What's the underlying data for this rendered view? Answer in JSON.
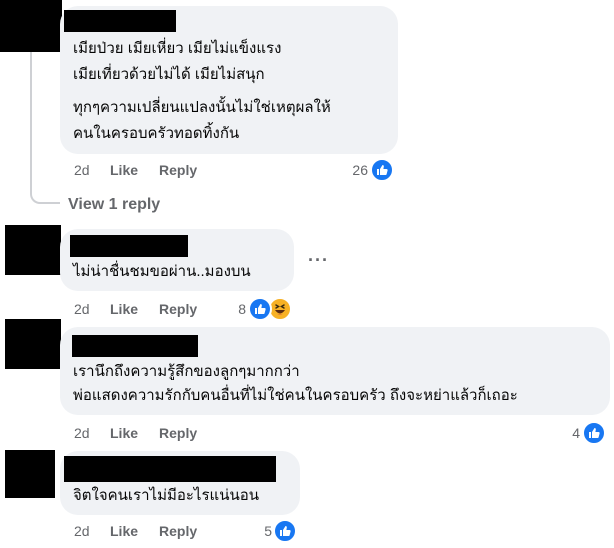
{
  "comments": [
    {
      "lines": [
        "เมียป่วย เมียเหี่ยว เมียไม่แข็งแรง",
        "เมียเที่ยวด้วยไม่ได้ เมียไม่สนุก",
        "ทุกๆความเปลี่ยนแปลงนั้นไม่ใช่เหตุผลให้",
        "คนในครอบครัวทอดทิ้งกัน"
      ],
      "time": "2d",
      "like": "Like",
      "reply": "Reply",
      "reactions": "26"
    },
    {
      "lines": [
        "ไม่น่าชื่นชมขอผ่าน..มองบน"
      ],
      "time": "2d",
      "like": "Like",
      "reply": "Reply",
      "reactions": "8"
    },
    {
      "lines": [
        "เรานึกถึงความรู้สึกของลูกๆมากกว่า",
        "พ่อแสดงความรักกับคนอื่นที่ไม่ใช่คนในครอบครัว ถึงจะหย่าแล้วก็เถอะ"
      ],
      "time": "2d",
      "like": "Like",
      "reply": "Reply",
      "reactions": "4"
    },
    {
      "lines": [
        "จิตใจคนเราไม่มีอะไรแน่นอน"
      ],
      "time": "2d",
      "like": "Like",
      "reply": "Reply",
      "reactions": "5"
    }
  ],
  "view_replies": "View 1 reply",
  "more_options": "···",
  "icons": {
    "like": "thumbs-up-icon",
    "haha": "haha-emoji-icon",
    "more": "more-options-icon"
  },
  "colors": {
    "like_blue": "#1877f2",
    "bubble_bg": "#f0f2f5",
    "meta_gray": "#65676b"
  }
}
